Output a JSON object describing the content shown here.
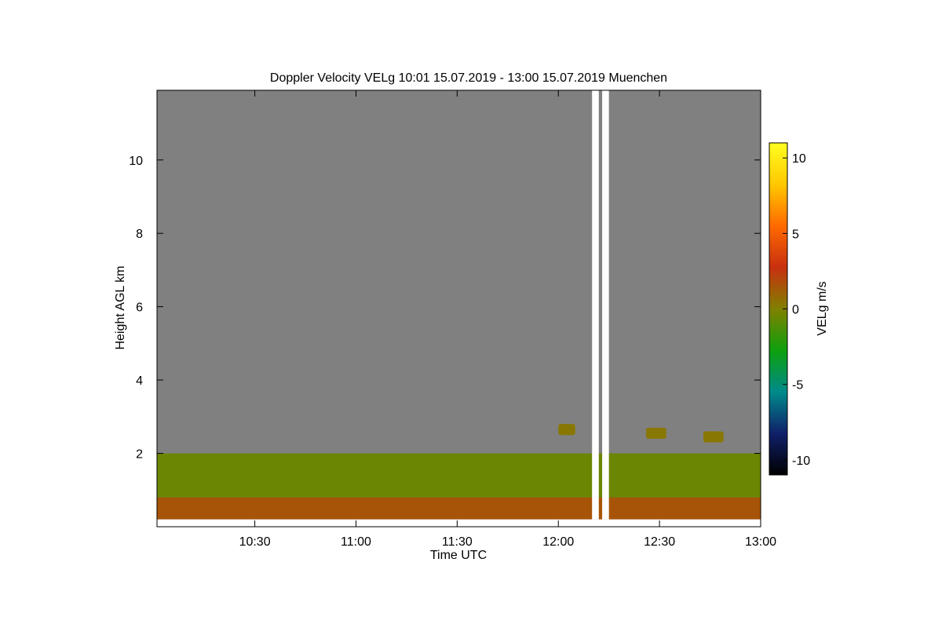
{
  "chart_data": {
    "type": "heatmap",
    "title": "Doppler Velocity VELg   10:01 15.07.2019 - 13:00 15.07.2019 Muenchen",
    "xlabel": "Time UTC",
    "ylabel": "Height AGL km",
    "x_ticks": [
      "10:30",
      "11:00",
      "11:30",
      "12:00",
      "12:30",
      "13:00"
    ],
    "x_tick_minutes": [
      630,
      660,
      690,
      720,
      750,
      780
    ],
    "xlim_minutes": [
      601,
      780
    ],
    "y_ticks": [
      2,
      4,
      6,
      8,
      10
    ],
    "ylim": [
      0,
      11.9
    ],
    "colorbar": {
      "label": "VELg m/s",
      "ticks": [
        -10,
        -5,
        0,
        5,
        10
      ],
      "range": [
        -11,
        11
      ],
      "colors": [
        "#000000",
        "#10206a",
        "#008a8a",
        "#0ea00e",
        "#808000",
        "#c83010",
        "#ff6a00",
        "#ffc800",
        "#ffff20"
      ]
    },
    "background_color": "#808080",
    "series": [
      {
        "layers": [
          {
            "height_km": [
              0.2,
              0.8
            ],
            "velocity_ms": 1.5
          },
          {
            "height_km": [
              0.8,
              2.0
            ],
            "velocity_ms": -0.5
          },
          {
            "height_km": [
              2.0,
              11.9
            ],
            "velocity_ms": 0
          }
        ],
        "no_data_windows_utc": [
          [
            "12:10",
            "12:12"
          ],
          [
            "12:13",
            "12:15"
          ]
        ],
        "elevated_patches": [
          {
            "time_utc": [
              "12:00",
              "12:05"
            ],
            "height_km": [
              2.5,
              2.8
            ]
          },
          {
            "time_utc": [
              "12:26",
              "12:32"
            ],
            "height_km": [
              2.4,
              2.7
            ]
          },
          {
            "time_utc": [
              "12:43",
              "12:49"
            ],
            "height_km": [
              2.3,
              2.6
            ]
          }
        ]
      }
    ]
  }
}
